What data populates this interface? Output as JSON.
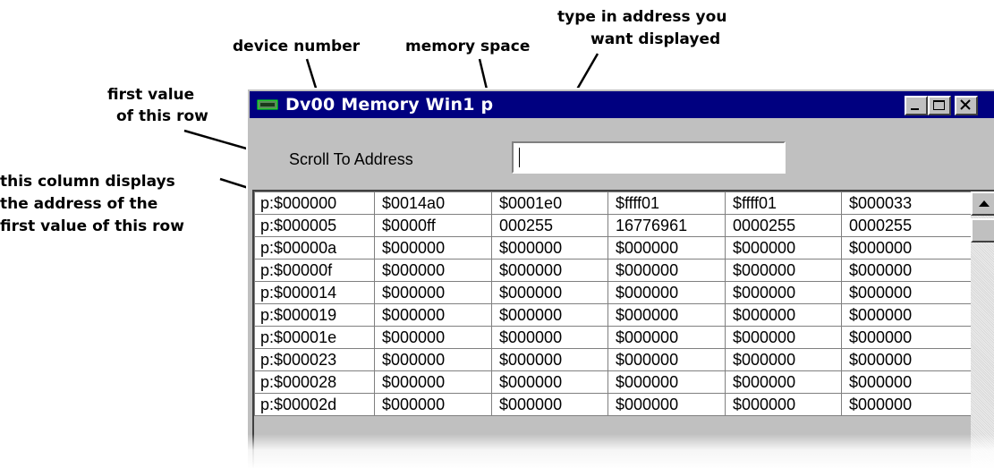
{
  "annotations": {
    "device_number": "device number",
    "memory_space": "memory space",
    "type_address_line1": "type in address you",
    "type_address_line2": "want displayed",
    "first_value_line1": "first value",
    "first_value_line2": "of this row",
    "column_line1": "this column displays",
    "column_line2": "the address of the",
    "column_line3": "first value of this row"
  },
  "window": {
    "title": "Dv00 Memory Win1  p",
    "icon": "device-app-icon",
    "controls": [
      "minimize",
      "maximize",
      "close"
    ],
    "titlebar_color": "#000080"
  },
  "scroll_to": {
    "label": "Scroll To Address",
    "value": ""
  },
  "memory_table": {
    "rows": [
      {
        "address": "p:$000000",
        "values": [
          "$0014a0",
          "$0001e0",
          "$ffff01",
          "$ffff01",
          "$000033"
        ]
      },
      {
        "address": "p:$000005",
        "values": [
          "$0000ff",
          "000255",
          "16776961",
          "0000255",
          "0000255"
        ]
      },
      {
        "address": "p:$00000a",
        "values": [
          "$000000",
          "$000000",
          "$000000",
          "$000000",
          "$000000"
        ]
      },
      {
        "address": "p:$00000f",
        "values": [
          "$000000",
          "$000000",
          "$000000",
          "$000000",
          "$000000"
        ]
      },
      {
        "address": "p:$000014",
        "values": [
          "$000000",
          "$000000",
          "$000000",
          "$000000",
          "$000000"
        ]
      },
      {
        "address": "p:$000019",
        "values": [
          "$000000",
          "$000000",
          "$000000",
          "$000000",
          "$000000"
        ]
      },
      {
        "address": "p:$00001e",
        "values": [
          "$000000",
          "$000000",
          "$000000",
          "$000000",
          "$000000"
        ]
      },
      {
        "address": "p:$000023",
        "values": [
          "$000000",
          "$000000",
          "$000000",
          "$000000",
          "$000000"
        ]
      },
      {
        "address": "p:$000028",
        "values": [
          "$000000",
          "$000000",
          "$000000",
          "$000000",
          "$000000"
        ]
      },
      {
        "address": "p:$00002d",
        "values": [
          "$000000",
          "$000000",
          "$000000",
          "$000000",
          "$000000"
        ]
      }
    ]
  }
}
